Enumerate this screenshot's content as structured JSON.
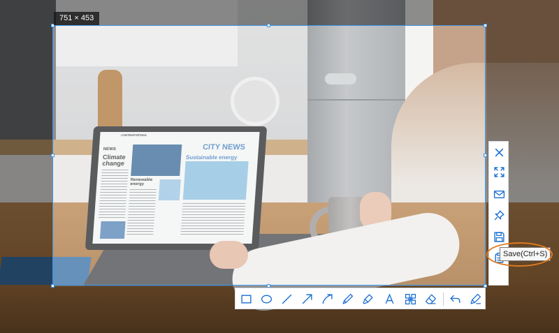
{
  "selection": {
    "size_label": "751 × 453"
  },
  "photo": {
    "screen_brand": "CONTRAPORTADA",
    "headline_left": "NEWS",
    "story_title": "Climate change",
    "story_sub": "Renewable energy",
    "headline_right": "CITY NEWS",
    "right_sub": "Sustainable energy"
  },
  "side_toolbar": [
    {
      "name": "close-icon",
      "tooltip": ""
    },
    {
      "name": "fullscreen-icon",
      "tooltip": ""
    },
    {
      "name": "mail-icon",
      "tooltip": ""
    },
    {
      "name": "pin-icon",
      "tooltip": ""
    },
    {
      "name": "save-icon",
      "tooltip": "Save(Ctrl+S)"
    },
    {
      "name": "clipboard-icon",
      "tooltip": ""
    }
  ],
  "tooltip": {
    "text": "Save(Ctrl+S)"
  },
  "bottom_toolbar": [
    "rectangle-icon",
    "ellipse-icon",
    "line-icon",
    "arrow-icon",
    "curved-arrow-icon",
    "pen-icon",
    "marker-icon",
    "text-icon",
    "mosaic-icon",
    "eraser-icon",
    "undo-icon",
    "done-icon"
  ],
  "colors": {
    "accent": "#3a93e6",
    "icon": "#1a6fd1",
    "highlight": "#e17a20"
  }
}
